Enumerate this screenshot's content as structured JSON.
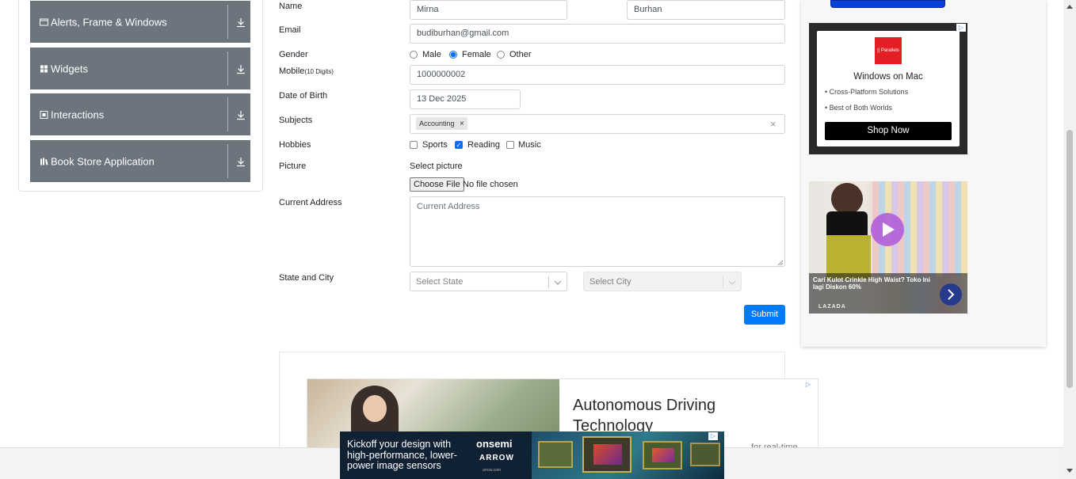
{
  "menu": {
    "groups": [
      {
        "label": "Alerts, Frame & Windows",
        "icon": "window-icon"
      },
      {
        "label": "Widgets",
        "icon": "widgets-icon"
      },
      {
        "label": "Interactions",
        "icon": "interactions-icon"
      },
      {
        "label": "Book Store Application",
        "icon": "bookstore-icon"
      }
    ]
  },
  "form": {
    "name_label": "Name",
    "first_name": "Mirna",
    "last_name": "Burhan",
    "email_label": "Email",
    "email": "budiburhan@gmail.com",
    "gender_label": "Gender",
    "gender_options": [
      "Male",
      "Female",
      "Other"
    ],
    "gender_selected": "Female",
    "mobile_label": "Mobile",
    "mobile_hint": "(10 Digits)",
    "mobile": "1000000002",
    "dob_label": "Date of Birth",
    "dob": "13 Dec 2025",
    "subjects_label": "Subjects",
    "subject_chip": "Accounting",
    "chip_remove": "×",
    "clear_all": "×",
    "hobbies_label": "Hobbies",
    "hobbies": [
      "Sports",
      "Reading",
      "Music"
    ],
    "hobbies_checked": [
      "Reading"
    ],
    "picture_label": "Picture",
    "select_picture": "Select picture",
    "choose_file": "Choose File",
    "no_file": "No file chosen",
    "address_label": "Current Address",
    "address_placeholder": "Current Address",
    "state_city_label": "State and City",
    "state_placeholder": "Select State",
    "city_placeholder": "Select City",
    "submit": "Submit"
  },
  "ads": {
    "mac": {
      "brand": "|| Parallels",
      "title": "Windows on Mac",
      "bullet1": "Cross-Platform Solutions",
      "bullet2": "Best of Both Worlds",
      "cta": "Shop Now"
    },
    "lazada": {
      "caption": "Cari Kulot Crinkle High Waist? Toko Ini lagi Diskon 60%",
      "brand": "LAZADA"
    },
    "bottom": {
      "headline_line1": "Autonomous Driving",
      "headline_line2": "Technology",
      "cut_text": "for real-time"
    },
    "banner": {
      "line1": "Kickoff your design with",
      "line2": "high-performance, lower-",
      "line3": "power image sensors",
      "brand1": "onsemi",
      "brand2": "ARROW",
      "brand2_sub": "arrow.com"
    }
  },
  "colors": {
    "menu_bg": "#6c757d",
    "primary": "#007bff",
    "ad_dark": "#2a2a2a"
  }
}
